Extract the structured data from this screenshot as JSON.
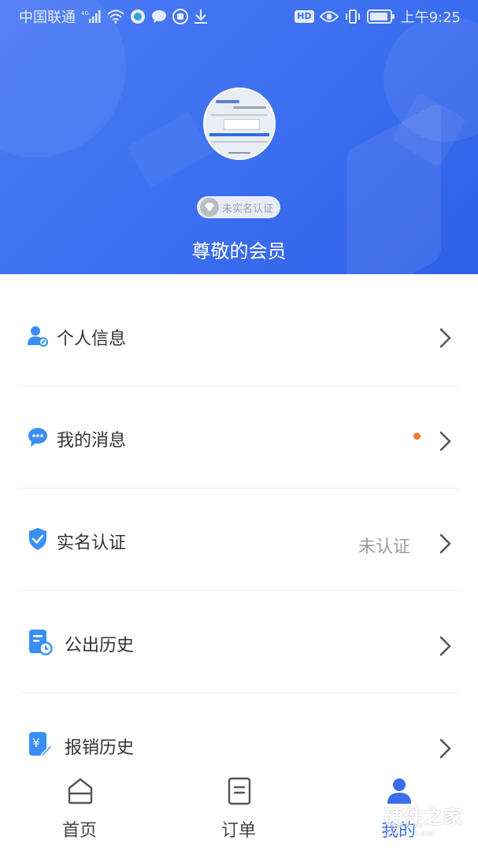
{
  "status_bar": {
    "carrier": "中国联通",
    "network": "4G",
    "time": "上午9:25",
    "hd": "HD"
  },
  "profile": {
    "verify_badge": "未实名认证",
    "member_name": "尊敬的会员"
  },
  "menu": {
    "items": [
      {
        "label": "个人信息",
        "icon": "user-edit-icon"
      },
      {
        "label": "我的消息",
        "icon": "chat-bubble-icon",
        "has_unread_dot": true
      },
      {
        "label": "实名认证",
        "icon": "shield-check-icon",
        "value": "未认证"
      },
      {
        "label": "公出历史",
        "icon": "document-clock-icon"
      },
      {
        "label": "报销历史",
        "icon": "yuan-document-icon"
      }
    ]
  },
  "bottom_nav": {
    "tabs": [
      {
        "label": "首页",
        "icon": "home-icon",
        "active": false
      },
      {
        "label": "订单",
        "icon": "order-list-icon",
        "active": false
      },
      {
        "label": "我的",
        "icon": "person-icon",
        "active": true
      }
    ]
  },
  "watermark": {
    "text": "硬件之家",
    "sub": "YINGJIAN ZHIJIA.COM"
  },
  "colors": {
    "header_gradient_start": "#4b7bf5",
    "header_gradient_end": "#2f5fe6",
    "accent_blue": "#3a6cf0",
    "icon_blue": "#3a8ef6",
    "unread_dot": "#ef7d33"
  }
}
